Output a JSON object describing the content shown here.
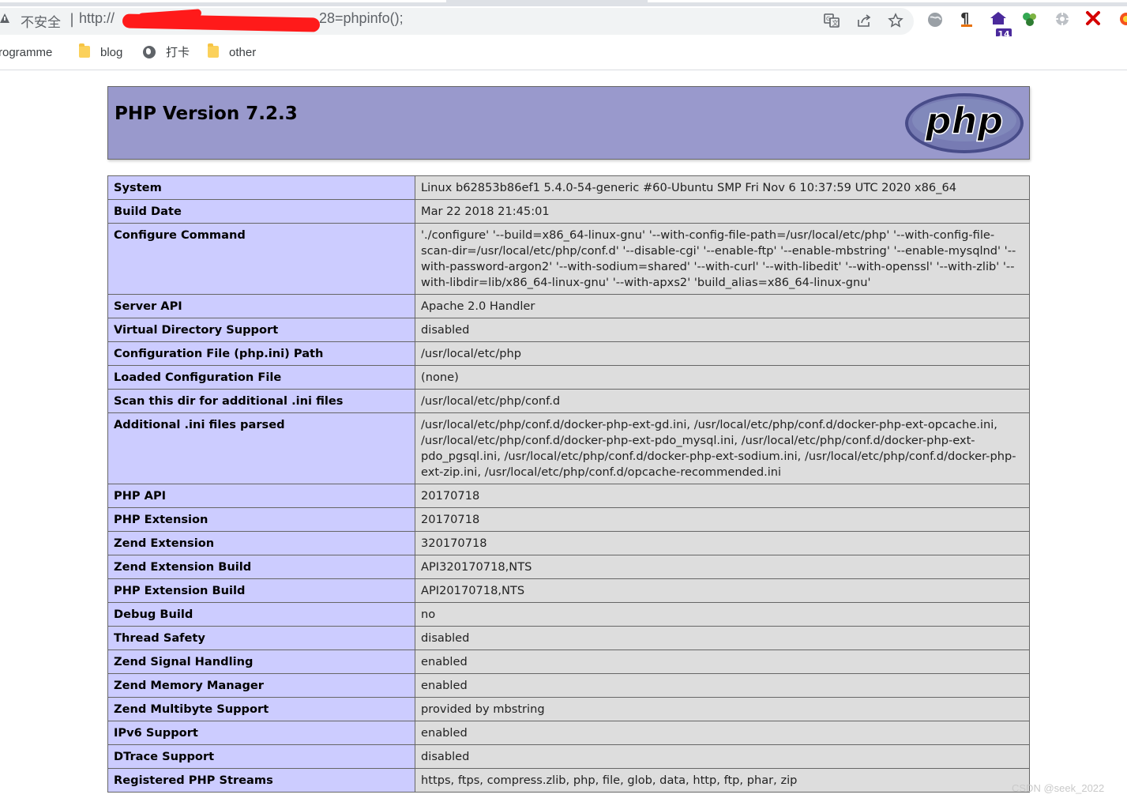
{
  "browser": {
    "security_label": "不安全",
    "url_prefix": "http://",
    "url_suffix": "28=phpinfo();",
    "extension_badge": "14",
    "bookmarks": [
      {
        "label": "rogramme"
      },
      {
        "label": "blog"
      },
      {
        "label": "打卡"
      },
      {
        "label": "other"
      }
    ]
  },
  "page": {
    "title": "PHP Version 7.2.3",
    "logo_text": "php",
    "rows": [
      {
        "key": "System",
        "value": "Linux b62853b86ef1 5.4.0-54-generic #60-Ubuntu SMP Fri Nov 6 10:37:59 UTC 2020 x86_64"
      },
      {
        "key": "Build Date",
        "value": "Mar 22 2018 21:45:01"
      },
      {
        "key": "Configure Command",
        "value": "'./configure' '--build=x86_64-linux-gnu' '--with-config-file-path=/usr/local/etc/php' '--with-config-file-scan-dir=/usr/local/etc/php/conf.d' '--disable-cgi' '--enable-ftp' '--enable-mbstring' '--enable-mysqlnd' '--with-password-argon2' '--with-sodium=shared' '--with-curl' '--with-libedit' '--with-openssl' '--with-zlib' '--with-libdir=lib/x86_64-linux-gnu' '--with-apxs2' 'build_alias=x86_64-linux-gnu'"
      },
      {
        "key": "Server API",
        "value": "Apache 2.0 Handler"
      },
      {
        "key": "Virtual Directory Support",
        "value": "disabled"
      },
      {
        "key": "Configuration File (php.ini) Path",
        "value": "/usr/local/etc/php"
      },
      {
        "key": "Loaded Configuration File",
        "value": "(none)"
      },
      {
        "key": "Scan this dir for additional .ini files",
        "value": "/usr/local/etc/php/conf.d"
      },
      {
        "key": "Additional .ini files parsed",
        "value": "/usr/local/etc/php/conf.d/docker-php-ext-gd.ini, /usr/local/etc/php/conf.d/docker-php-ext-opcache.ini, /usr/local/etc/php/conf.d/docker-php-ext-pdo_mysql.ini, /usr/local/etc/php/conf.d/docker-php-ext-pdo_pgsql.ini, /usr/local/etc/php/conf.d/docker-php-ext-sodium.ini, /usr/local/etc/php/conf.d/docker-php-ext-zip.ini, /usr/local/etc/php/conf.d/opcache-recommended.ini"
      },
      {
        "key": "PHP API",
        "value": "20170718"
      },
      {
        "key": "PHP Extension",
        "value": "20170718"
      },
      {
        "key": "Zend Extension",
        "value": "320170718"
      },
      {
        "key": "Zend Extension Build",
        "value": "API320170718,NTS"
      },
      {
        "key": "PHP Extension Build",
        "value": "API20170718,NTS"
      },
      {
        "key": "Debug Build",
        "value": "no"
      },
      {
        "key": "Thread Safety",
        "value": "disabled"
      },
      {
        "key": "Zend Signal Handling",
        "value": "enabled"
      },
      {
        "key": "Zend Memory Manager",
        "value": "enabled"
      },
      {
        "key": "Zend Multibyte Support",
        "value": "provided by mbstring"
      },
      {
        "key": "IPv6 Support",
        "value": "enabled"
      },
      {
        "key": "DTrace Support",
        "value": "disabled"
      },
      {
        "key": "Registered PHP Streams",
        "value": "https, ftps, compress.zlib, php, file, glob, data, http, ftp, phar, zip"
      }
    ]
  },
  "watermark": "CSDN @seek_2022",
  "colors": {
    "header_bg": "#9999cc",
    "key_bg": "#ccccff",
    "value_bg": "#dddddd",
    "redaction": "#ff1a1a"
  }
}
